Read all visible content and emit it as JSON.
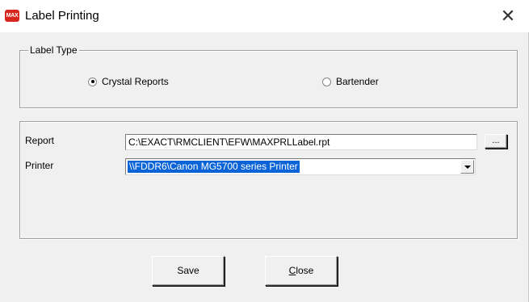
{
  "window": {
    "title": "Label Printing",
    "icon_text": "MAX",
    "close_glyph": "✕"
  },
  "label_type": {
    "legend": "Label Type",
    "options": [
      {
        "label": "Crystal Reports",
        "checked": true
      },
      {
        "label": "Bartender",
        "checked": false
      }
    ]
  },
  "settings": {
    "report_label": "Report",
    "report_value": "C:\\EXACT\\RMCLIENT\\EFW\\MAXPRLLabel.rpt",
    "browse_label": "...",
    "printer_label": "Printer",
    "printer_value": "\\\\FDDR6\\Canon MG5700 series Printer"
  },
  "buttons": {
    "save_label": "Save",
    "close_mnemonic": "C",
    "close_rest": "lose"
  }
}
